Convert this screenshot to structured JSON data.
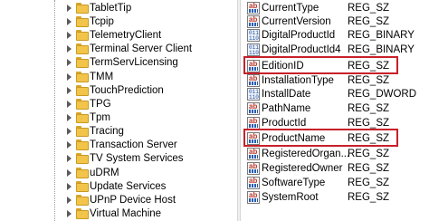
{
  "tree": {
    "items": [
      {
        "label": "TabletTip"
      },
      {
        "label": "Tcpip"
      },
      {
        "label": "TelemetryClient"
      },
      {
        "label": "Terminal Server Client"
      },
      {
        "label": "TermServLicensing"
      },
      {
        "label": "TMM"
      },
      {
        "label": "TouchPrediction"
      },
      {
        "label": "TPG"
      },
      {
        "label": "Tpm"
      },
      {
        "label": "Tracing"
      },
      {
        "label": "Transaction Server"
      },
      {
        "label": "TV System Services"
      },
      {
        "label": "uDRM"
      },
      {
        "label": "Update Services"
      },
      {
        "label": "UPnP Device Host"
      },
      {
        "label": "Virtual Machine"
      }
    ]
  },
  "values": {
    "items": [
      {
        "name": "CurrentType",
        "type": "REG_SZ",
        "icon": "string-value-icon"
      },
      {
        "name": "CurrentVersion",
        "type": "REG_SZ",
        "icon": "string-value-icon"
      },
      {
        "name": "DigitalProductId",
        "type": "REG_BINARY",
        "icon": "binary-value-icon"
      },
      {
        "name": "DigitalProductId4",
        "type": "REG_BINARY",
        "icon": "binary-value-icon"
      },
      {
        "name": "EditionID",
        "type": "REG_SZ",
        "icon": "string-value-icon",
        "highlighted": true
      },
      {
        "name": "InstallationType",
        "type": "REG_SZ",
        "icon": "string-value-icon"
      },
      {
        "name": "InstallDate",
        "type": "REG_DWORD",
        "icon": "binary-value-icon"
      },
      {
        "name": "PathName",
        "type": "REG_SZ",
        "icon": "string-value-icon"
      },
      {
        "name": "ProductId",
        "type": "REG_SZ",
        "icon": "string-value-icon"
      },
      {
        "name": "ProductName",
        "type": "REG_SZ",
        "icon": "string-value-icon",
        "highlighted": true
      },
      {
        "name": "RegisteredOrgan...",
        "type": "REG_SZ",
        "icon": "string-value-icon"
      },
      {
        "name": "RegisteredOwner",
        "type": "REG_SZ",
        "icon": "string-value-icon"
      },
      {
        "name": "SoftwareType",
        "type": "REG_SZ",
        "icon": "string-value-icon"
      },
      {
        "name": "SystemRoot",
        "type": "REG_SZ",
        "icon": "string-value-icon"
      }
    ]
  },
  "colors": {
    "highlight_border": "#c8202a",
    "folder": "#f2c54a"
  }
}
